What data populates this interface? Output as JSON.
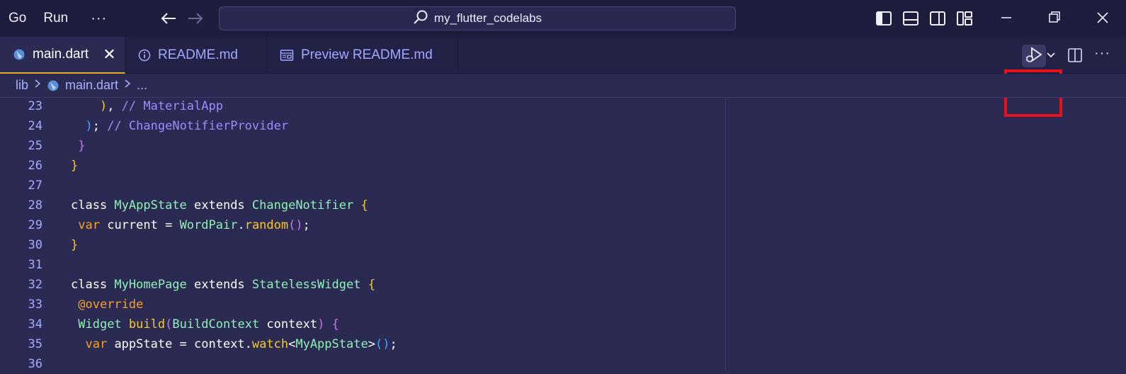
{
  "titlebar": {
    "menu": [
      "Go",
      "Run"
    ],
    "more": "···",
    "search_text": "my_flutter_codelabs"
  },
  "tabs": [
    {
      "label": "main.dart",
      "icon": "dart-icon",
      "active": true,
      "close": "✕"
    },
    {
      "label": "README.md",
      "icon": "info-icon",
      "active": false
    },
    {
      "label": "Preview README.md",
      "icon": "preview-icon",
      "active": false
    }
  ],
  "breadcrumb": {
    "folder": "lib",
    "file": "main.dart",
    "rest": "..."
  },
  "editor_actions": {
    "more": "···"
  },
  "colors": {
    "highlight_box": "#e8101a",
    "active_tab_border": "#e0b11c",
    "editor_bg": "#2b2a53"
  },
  "code": {
    "lines": [
      {
        "n": "23",
        "parts": [
          [
            "    ",
            "c-txt"
          ],
          [
            ")",
            "b-yel"
          ],
          [
            ", ",
            "c-txt"
          ],
          [
            "// MaterialApp",
            "c-com"
          ]
        ]
      },
      {
        "n": "24",
        "parts": [
          [
            "  ",
            "c-txt"
          ],
          [
            ")",
            "b-blu"
          ],
          [
            "; ",
            "c-txt"
          ],
          [
            "// ChangeNotifierProvider",
            "c-com"
          ]
        ]
      },
      {
        "n": "25",
        "parts": [
          [
            " ",
            "c-txt"
          ],
          [
            "}",
            "b-pur"
          ]
        ]
      },
      {
        "n": "26",
        "parts": [
          [
            "}",
            "b-yel"
          ]
        ]
      },
      {
        "n": "27",
        "parts": []
      },
      {
        "n": "28",
        "parts": [
          [
            "class ",
            "c-kw"
          ],
          [
            "MyAppState",
            "c-type"
          ],
          [
            " extends ",
            "c-kw"
          ],
          [
            "ChangeNotifier",
            "c-type"
          ],
          [
            " ",
            "c-txt"
          ],
          [
            "{",
            "b-yel"
          ]
        ]
      },
      {
        "n": "29",
        "parts": [
          [
            " ",
            "c-txt"
          ],
          [
            "var",
            "c-var"
          ],
          [
            " current = ",
            "c-txt"
          ],
          [
            "WordPair",
            "c-type"
          ],
          [
            ".",
            "c-txt"
          ],
          [
            "random",
            "c-fn"
          ],
          [
            "(",
            "b-pur"
          ],
          [
            ")",
            "b-pur"
          ],
          [
            ";",
            "c-txt"
          ]
        ]
      },
      {
        "n": "30",
        "parts": [
          [
            "}",
            "b-yel"
          ]
        ]
      },
      {
        "n": "31",
        "parts": []
      },
      {
        "n": "32",
        "parts": [
          [
            "class ",
            "c-kw"
          ],
          [
            "MyHomePage",
            "c-type"
          ],
          [
            " extends ",
            "c-kw"
          ],
          [
            "StatelessWidget",
            "c-type"
          ],
          [
            " ",
            "c-txt"
          ],
          [
            "{",
            "b-yel"
          ]
        ]
      },
      {
        "n": "33",
        "parts": [
          [
            " ",
            "c-txt"
          ],
          [
            "@override",
            "c-ann"
          ]
        ]
      },
      {
        "n": "34",
        "parts": [
          [
            " ",
            "c-txt"
          ],
          [
            "Widget",
            "c-type"
          ],
          [
            " ",
            "c-txt"
          ],
          [
            "build",
            "c-fn"
          ],
          [
            "(",
            "b-pur"
          ],
          [
            "BuildContext",
            "c-type"
          ],
          [
            " context",
            "c-txt"
          ],
          [
            ")",
            "b-pur"
          ],
          [
            " ",
            "c-txt"
          ],
          [
            "{",
            "b-pur"
          ]
        ]
      },
      {
        "n": "35",
        "parts": [
          [
            "  ",
            "c-txt"
          ],
          [
            "var",
            "c-var"
          ],
          [
            " appState = context.",
            "c-txt"
          ],
          [
            "watch",
            "c-fn"
          ],
          [
            "<",
            "c-txt"
          ],
          [
            "MyAppState",
            "c-type"
          ],
          [
            ">",
            "c-txt"
          ],
          [
            "(",
            "b-blu"
          ],
          [
            ")",
            "b-blu"
          ],
          [
            ";",
            "c-txt"
          ]
        ]
      },
      {
        "n": "36",
        "parts": []
      }
    ]
  }
}
